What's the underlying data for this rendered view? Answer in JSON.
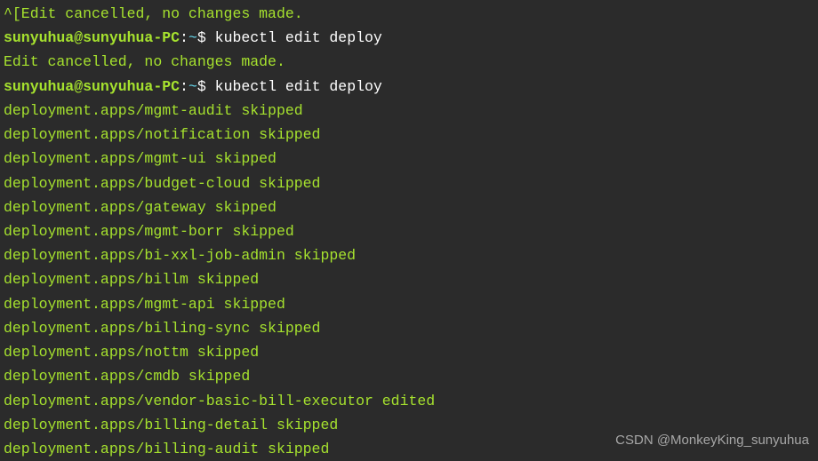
{
  "lines": [
    {
      "type": "output",
      "text": "^[Edit cancelled, no changes made."
    },
    {
      "type": "prompt",
      "user": "sunyuhua@sunyuhua-PC",
      "path": "~",
      "command": "kubectl edit deploy"
    },
    {
      "type": "output",
      "text": "Edit cancelled, no changes made."
    },
    {
      "type": "prompt",
      "user": "sunyuhua@sunyuhua-PC",
      "path": "~",
      "command": "kubectl edit deploy"
    },
    {
      "type": "output",
      "text": "deployment.apps/mgmt-audit skipped"
    },
    {
      "type": "output",
      "text": "deployment.apps/notification skipped"
    },
    {
      "type": "output",
      "text": "deployment.apps/mgmt-ui skipped"
    },
    {
      "type": "output",
      "text": "deployment.apps/budget-cloud skipped"
    },
    {
      "type": "output",
      "text": "deployment.apps/gateway skipped"
    },
    {
      "type": "output",
      "text": "deployment.apps/mgmt-borr skipped"
    },
    {
      "type": "output",
      "text": "deployment.apps/bi-xxl-job-admin skipped"
    },
    {
      "type": "output",
      "text": "deployment.apps/billm skipped"
    },
    {
      "type": "output",
      "text": "deployment.apps/mgmt-api skipped"
    },
    {
      "type": "output",
      "text": "deployment.apps/billing-sync skipped"
    },
    {
      "type": "output",
      "text": "deployment.apps/nottm skipped"
    },
    {
      "type": "output",
      "text": "deployment.apps/cmdb skipped"
    },
    {
      "type": "output",
      "text": "deployment.apps/vendor-basic-bill-executor edited"
    },
    {
      "type": "output",
      "text": "deployment.apps/billing-detail skipped"
    },
    {
      "type": "output",
      "text": "deployment.apps/billing-audit skipped"
    }
  ],
  "watermark": "CSDN @MonkeyKing_sunyuhua"
}
